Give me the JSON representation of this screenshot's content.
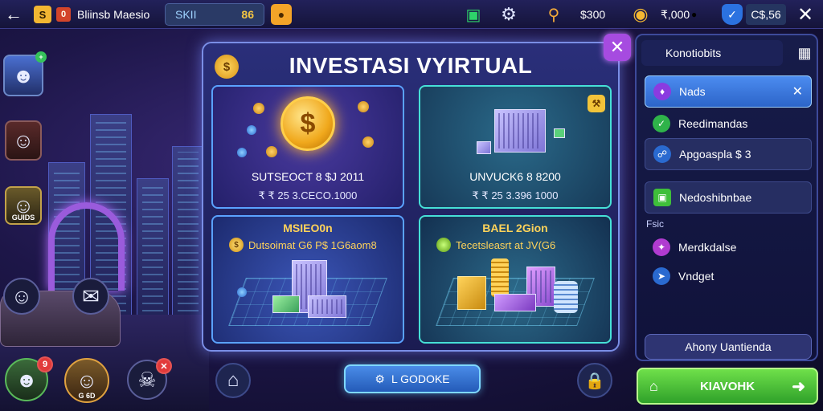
{
  "topbar": {
    "back_icon": "arrow-left-icon",
    "logo_glyph": "S",
    "badge_glyph": "0",
    "title": "Bliinsb Maesio",
    "field_label": "SKII",
    "field_value": "86",
    "val1": "$300",
    "val2": "₹,000",
    "val3": "C$,56"
  },
  "avatars": [
    {
      "caption": ""
    },
    {
      "caption": ""
    },
    {
      "caption": "GUIDS"
    },
    {
      "caption": ""
    }
  ],
  "bottom_avatars": [
    {
      "badge": "9"
    },
    {
      "caption": "G 6D"
    },
    {
      "badge": "✕"
    }
  ],
  "panel": {
    "title": "INVESTASI VYIRTUAL",
    "cards": [
      {
        "name": "SUTSEOCT 8 $J 2011",
        "value": "₹ ₹ 25 3.CECO.1000"
      },
      {
        "name": "UNVUCK6 8 8200",
        "value": "₹ ₹ 25 3.396 1000"
      },
      {
        "heading": "MSIEO0n",
        "sub": "Dutsoimat G6 P$ 1G6aom8"
      },
      {
        "heading": "BAEL 2Gion",
        "sub": "Tecetsleasrt at JV(G6"
      }
    ]
  },
  "bottom_button": "L GODOKE",
  "right_panel": {
    "tab_label": "Konotiobits",
    "items": [
      {
        "label": "Nads",
        "color": "#8a3be0"
      },
      {
        "label": "Reedimandas",
        "color": "#2fb34a"
      },
      {
        "label": "Apgoaspla $ 3",
        "color": "#2a6ad0"
      },
      {
        "label": "Nedoshibnbae",
        "color": "#3fbf3a"
      }
    ],
    "section_label": "Fsic",
    "items2": [
      {
        "label": "Merdkdalse",
        "color": "#b03bd0"
      },
      {
        "label": "Vndget",
        "color": "#2a6ad0"
      }
    ],
    "bottom_button": "Ahony Uantienda"
  },
  "green_button": "KIAVOHK",
  "colors": {
    "accent": "#7a8ee6",
    "gold": "#f4b832",
    "green": "#2fa12a",
    "purple": "#a64be0"
  }
}
